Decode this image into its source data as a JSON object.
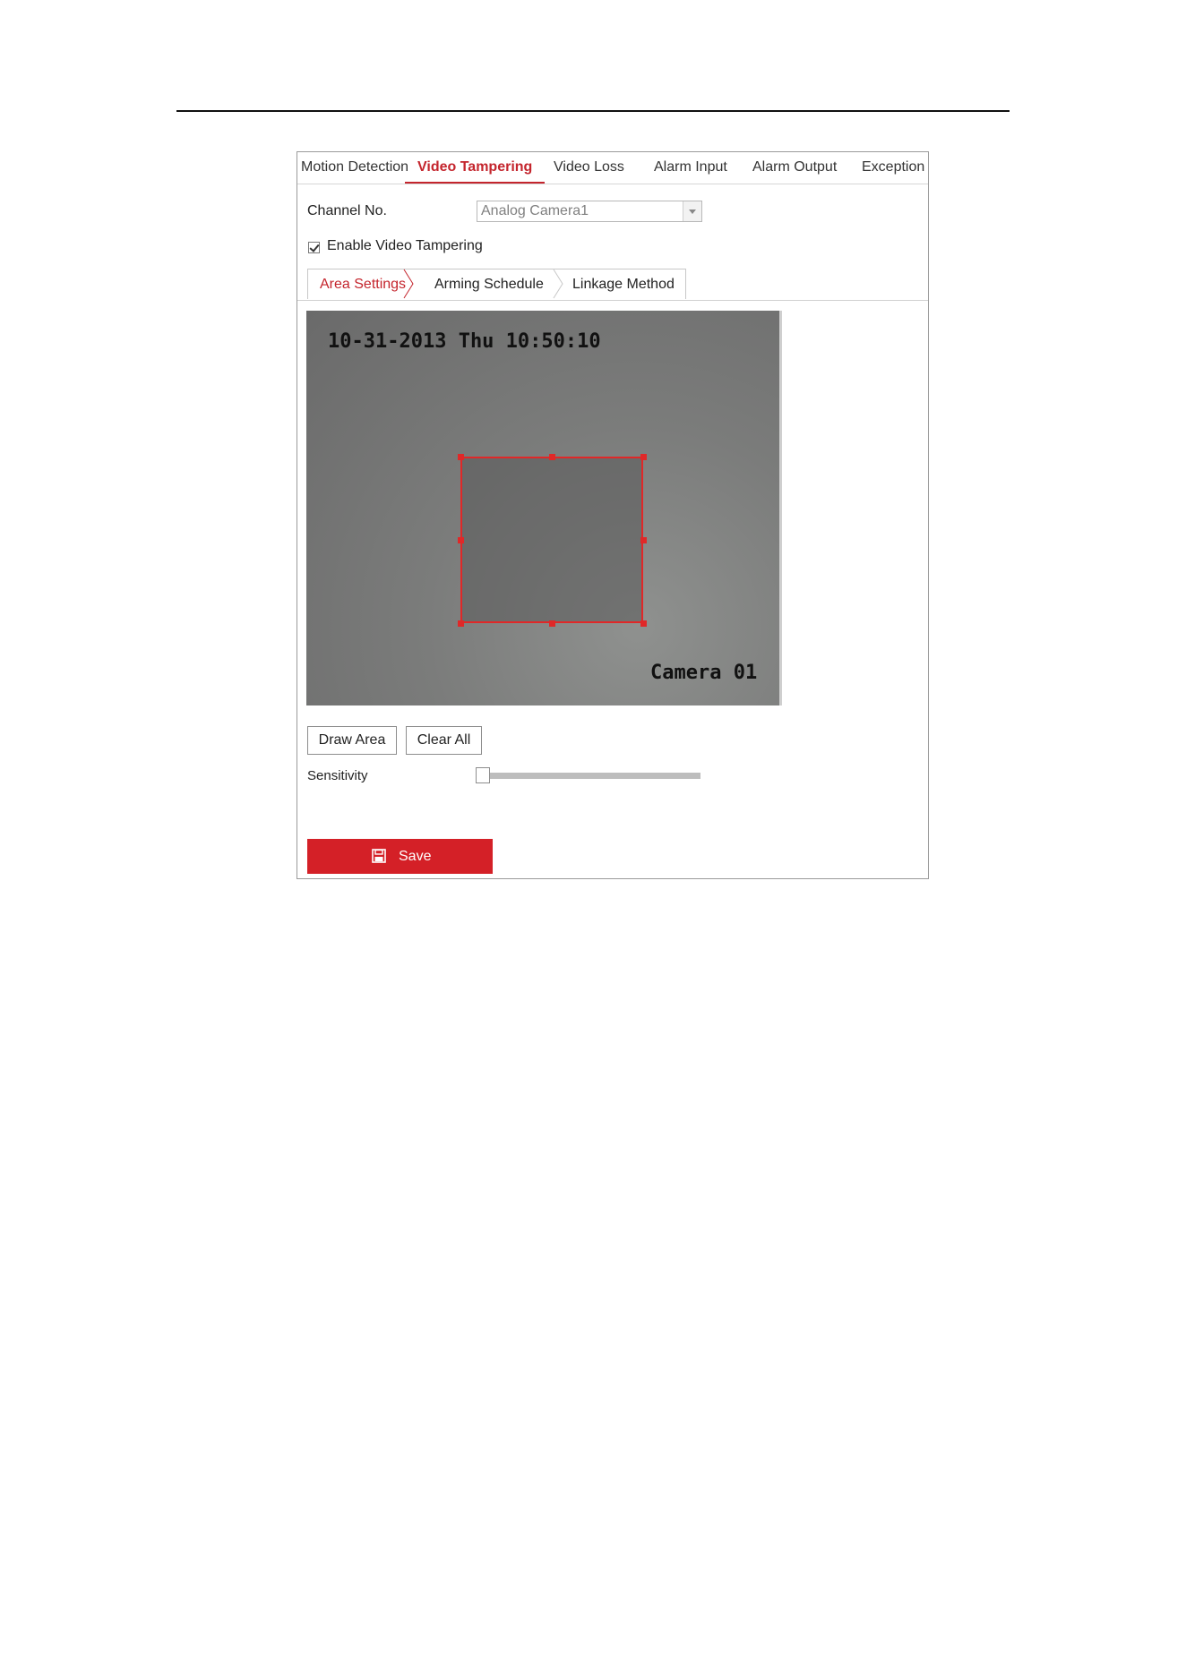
{
  "main_tabs": {
    "motion_detection": "Motion Detection",
    "video_tampering": "Video Tampering",
    "video_loss": "Video Loss",
    "alarm_input": "Alarm Input",
    "alarm_output": "Alarm Output",
    "exception": "Exception",
    "active": "Video Tampering"
  },
  "channel": {
    "label": "Channel No.",
    "value": "Analog Camera1"
  },
  "enable": {
    "label": "Enable Video Tampering",
    "checked": true
  },
  "sub_tabs": {
    "area_settings": "Area Settings",
    "arming_schedule": "Arming Schedule",
    "linkage_method": "Linkage Method",
    "active": "Area Settings"
  },
  "video": {
    "timestamp": "10-31-2013 Thu 10:50:10",
    "camera_name": "Camera 01"
  },
  "buttons": {
    "draw_area": "Draw Area",
    "clear_all": "Clear All",
    "save": "Save"
  },
  "sensitivity": {
    "label": "Sensitivity",
    "level": 0
  },
  "colors": {
    "accent": "#c4252d",
    "save_button": "#d42027",
    "area_border": "#e02828"
  },
  "icons": {
    "save": "floppy-disk-icon",
    "dropdown": "chevron-down-icon"
  }
}
